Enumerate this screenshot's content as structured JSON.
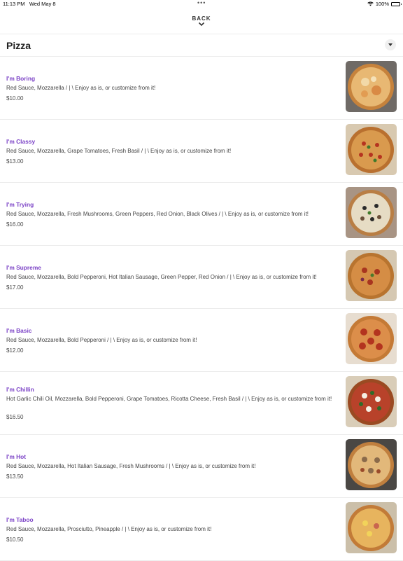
{
  "status_bar": {
    "time": "11:13 PM",
    "date": "Wed May 8",
    "battery": "100%"
  },
  "nav": {
    "back_label": "BACK"
  },
  "section": {
    "title": "Pizza"
  },
  "items": [
    {
      "name": "I'm Boring",
      "description": "Red Sauce, Mozzarella  / | \\  Enjoy as is, or customize from it!",
      "price": "$10.00"
    },
    {
      "name": "I'm Classy",
      "description": "Red Sauce, Mozzarella, Grape Tomatoes, Fresh Basil  / | \\  Enjoy as is, or customize from it!",
      "price": "$13.00"
    },
    {
      "name": "I'm Trying",
      "description": "Red Sauce, Mozzarella, Fresh Mushrooms, Green Peppers, Red Onion, Black Olives  / | \\  Enjoy as is, or customize from it!",
      "price": "$16.00"
    },
    {
      "name": "I'm Supreme",
      "description": "Red Sauce, Mozzarella, Bold Pepperoni, Hot Italian Sausage, Green Pepper, Red Onion  / | \\  Enjoy as is, or customize from it!",
      "price": "$17.00"
    },
    {
      "name": "I'm Basic",
      "description": "Red Sauce, Mozzarella, Bold Pepperoni  / | \\  Enjoy as is, or customize from it!",
      "price": "$12.00"
    },
    {
      "name": "I'm Chillin",
      "description": "Hot Garlic Chili Oil, Mozzarella, Bold Pepperoni, Grape Tomatoes, Ricotta Cheese, Fresh Basil  / | \\  Enjoy as is, or customize from it!",
      "price": "$16.50"
    },
    {
      "name": "I'm Hot",
      "description": "Red Sauce, Mozzarella, Hot Italian Sausage, Fresh Mushrooms   / | \\  Enjoy as is, or customize from it!",
      "price": "$13.50"
    },
    {
      "name": "I'm Taboo",
      "description": "Red Sauce, Mozzarella, Prosciutto, Pineapple   / | \\  Enjoy as is, or customize from it!",
      "price": "$10.50"
    }
  ],
  "colors": {
    "accent": "#7b42c6",
    "divider": "#ececec"
  }
}
